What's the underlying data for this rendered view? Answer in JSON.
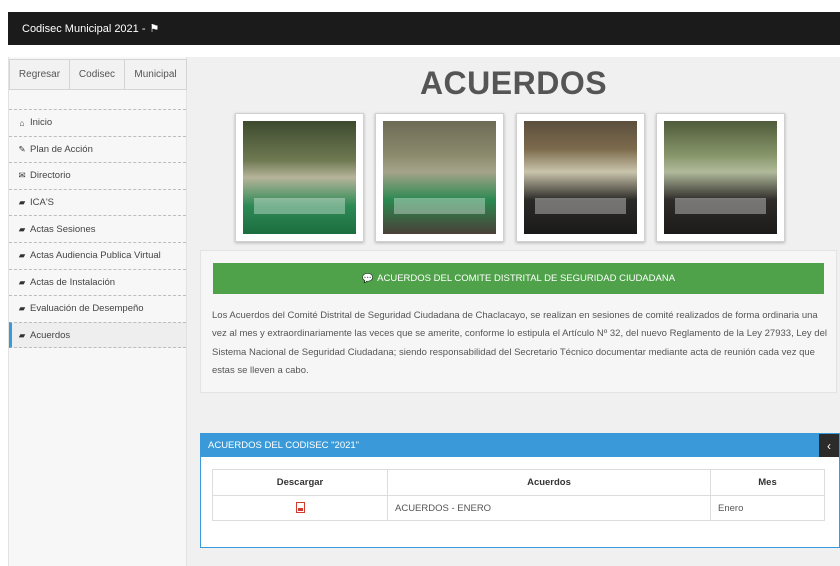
{
  "topbar": {
    "title": "Codisec Municipal 2021 -",
    "flag_icon": "flag-icon"
  },
  "sidebar": {
    "tabs": [
      {
        "label": "Regresar"
      },
      {
        "label": "Codisec"
      },
      {
        "label": "Municipal"
      }
    ],
    "items": [
      {
        "label": "Inicio",
        "icon": "home-icon"
      },
      {
        "label": "Plan de Acción",
        "icon": "edit-icon"
      },
      {
        "label": "Directorio",
        "icon": "envelope-icon"
      },
      {
        "label": "ICA'S",
        "icon": "book-icon"
      },
      {
        "label": "Actas Sesiones",
        "icon": "book-icon"
      },
      {
        "label": "Actas Audiencia Publica Virtual",
        "icon": "book-icon"
      },
      {
        "label": "Actas de Instalación",
        "icon": "book-icon"
      },
      {
        "label": "Evaluación de Desempeño",
        "icon": "book-icon"
      },
      {
        "label": "Acuerdos",
        "icon": "book-icon",
        "active": true
      }
    ]
  },
  "main": {
    "heading": "ACUERDOS",
    "panel": {
      "bar_label": "ACUERDOS DEL COMITE DISTRITAL DE SEGURIDAD CIUDADANA",
      "bar_color": "#4fa24a",
      "description": "Los Acuerdos del Comité Distrital de Seguridad Ciudadana de Chaclacayo, se realizan en sesiones de comité realizados de forma ordinaria una vez al mes y extraordinariamente las veces que se amerite, conforme lo estipula el Artículo Nº 32, del nuevo Reglamento de la Ley 27933, Ley del Sistema Nacional de Seguridad Ciudadana; siendo responsabilidad del Secretario Técnico documentar mediante acta de reunión cada vez que estas se lleven a cabo."
    },
    "box": {
      "title": "ACUERDOS DEL CODISEC \"2021\"",
      "toggle": "‹",
      "accent_color": "#3a9ad9",
      "columns": [
        "Descargar",
        "Acuerdos",
        "Mes"
      ],
      "rows": [
        {
          "download_icon": "pdf-icon",
          "acuerdo": "ACUERDOS - ENERO",
          "mes": "Enero"
        }
      ]
    }
  }
}
